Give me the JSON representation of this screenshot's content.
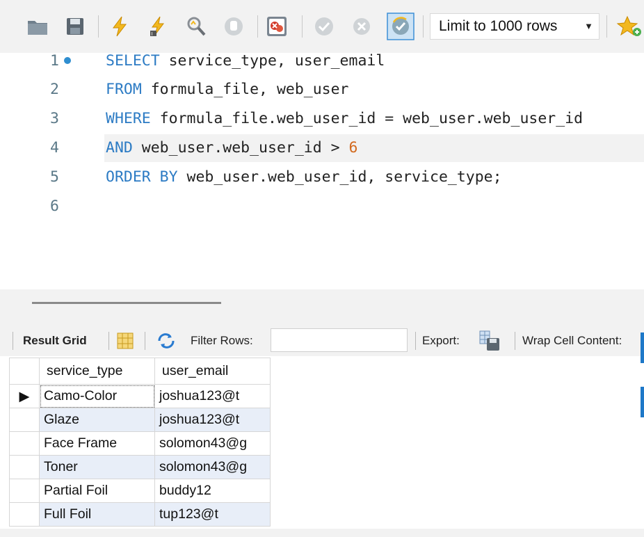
{
  "toolbar": {
    "limit_label": "Limit to 1000 rows",
    "icons": [
      "open-folder-icon",
      "save-icon",
      "execute-icon",
      "execute-current-icon",
      "explain-icon",
      "stop-icon",
      "toggle-error-icon",
      "commit-icon",
      "rollback-icon",
      "autocommit-icon",
      "beautify-icon"
    ]
  },
  "editor": {
    "lines": [
      {
        "n": "1",
        "kw1": "SELECT",
        "rest": " service_type, user_email"
      },
      {
        "n": "2",
        "kw1": "FROM",
        "rest": " formula_file, web_user"
      },
      {
        "n": "3",
        "kw1": "WHERE",
        "rest": " formula_file.web_user_id = web_user.web_user_id"
      },
      {
        "n": "4",
        "kw1": "AND",
        "rest": " web_user.web_user_id > ",
        "num": "6"
      },
      {
        "n": "5",
        "kw1": "ORDER BY",
        "rest": " web_user.web_user_id, service_type;"
      },
      {
        "n": "6",
        "kw1": "",
        "rest": ""
      }
    ]
  },
  "result_toolbar": {
    "result_grid": "Result Grid",
    "filter_rows": "Filter Rows:",
    "export": "Export:",
    "wrap": "Wrap Cell Content:"
  },
  "grid": {
    "headers": [
      "service_type",
      "user_email"
    ],
    "rows": [
      [
        "Camo-Color",
        "joshua123@t"
      ],
      [
        "Glaze",
        "joshua123@t"
      ],
      [
        "Face Frame",
        "solomon43@g"
      ],
      [
        "Toner",
        "solomon43@g"
      ],
      [
        "Partial Foil",
        "buddy12"
      ],
      [
        "Full Foil",
        "tup123@t"
      ]
    ]
  }
}
